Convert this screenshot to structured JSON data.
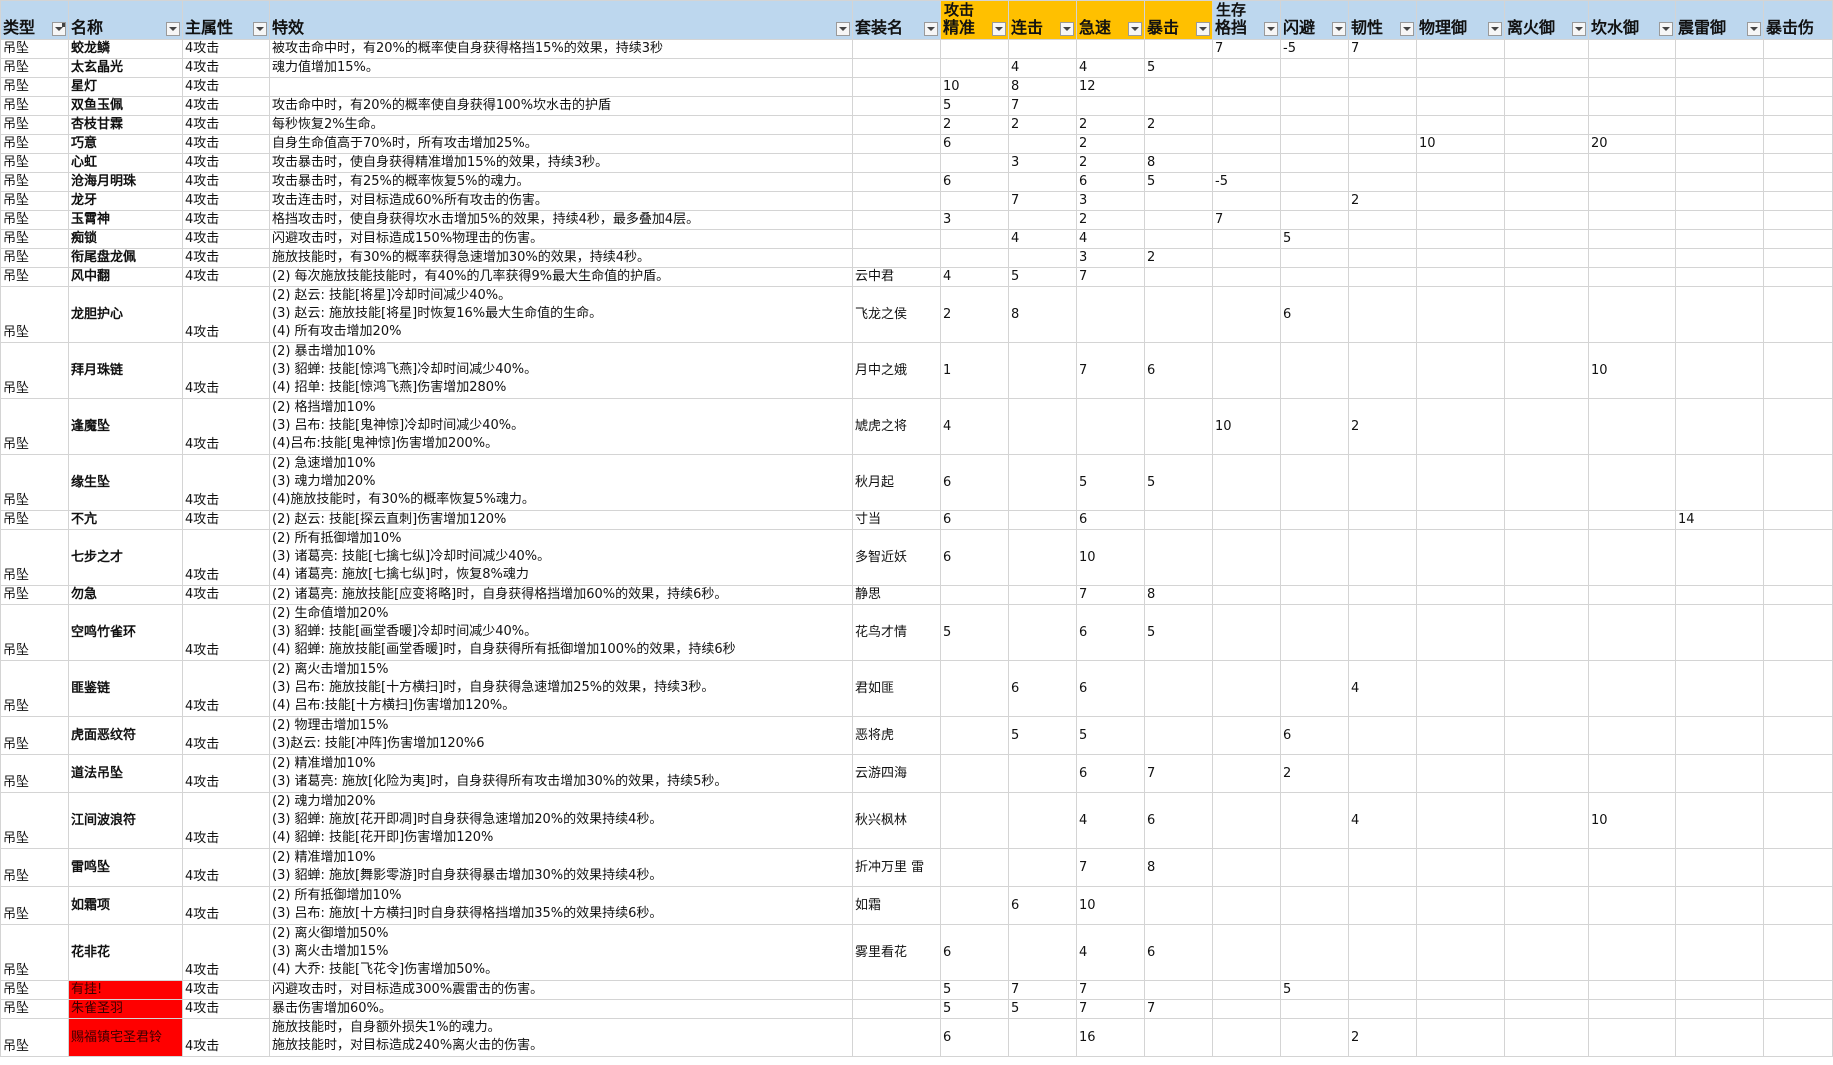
{
  "header": {
    "group_attack": "攻击",
    "group_survive": "生存",
    "columns": [
      "类型",
      "名称",
      "主属性",
      "特效",
      "套装名",
      "精准",
      "连击",
      "急速",
      "暴击",
      "格挡",
      "闪避",
      "韧性",
      "物理御",
      "离火御",
      "坎水御",
      "震雷御",
      "暴击伤"
    ]
  },
  "rows": [
    {
      "type": "吊坠",
      "name": "蛟龙鳞",
      "main": "4攻击",
      "effect": [
        "被攻击命中时，有20%的概率使自身获得格挡15%的效果，持续3秒"
      ],
      "set": "",
      "stats": [
        "",
        "",
        "",
        "",
        "7",
        "-5",
        "7",
        "",
        "",
        "",
        "",
        ""
      ]
    },
    {
      "type": "吊坠",
      "name": "太玄晶光",
      "main": "4攻击",
      "effect": [
        "魂力值增加15%。"
      ],
      "set": "",
      "stats": [
        "",
        "4",
        "4",
        "5",
        "",
        "",
        "",
        "",
        "",
        "",
        "",
        ""
      ]
    },
    {
      "type": "吊坠",
      "name": "星灯",
      "main": "4攻击",
      "effect": [
        ""
      ],
      "set": "",
      "stats": [
        "10",
        "8",
        "12",
        "",
        "",
        "",
        "",
        "",
        "",
        "",
        "",
        ""
      ]
    },
    {
      "type": "吊坠",
      "name": "双鱼玉佩",
      "main": "4攻击",
      "effect": [
        "攻击命中时，有20%的概率使自身获得100%坎水击的护盾"
      ],
      "set": "",
      "stats": [
        "5",
        "7",
        "",
        "",
        "",
        "",
        "",
        "",
        "",
        "",
        "",
        ""
      ]
    },
    {
      "type": "吊坠",
      "name": "杏枝甘霖",
      "main": "4攻击",
      "effect": [
        "每秒恢复2%生命。"
      ],
      "set": "",
      "stats": [
        "2",
        "2",
        "2",
        "2",
        "",
        "",
        "",
        "",
        "",
        "",
        "",
        ""
      ]
    },
    {
      "type": "吊坠",
      "name": "巧意",
      "main": "4攻击",
      "effect": [
        "自身生命值高于70%时，所有攻击增加25%。"
      ],
      "set": "",
      "stats": [
        "6",
        "",
        "2",
        "",
        "",
        "",
        "",
        "10",
        "",
        "20",
        "",
        ""
      ]
    },
    {
      "type": "吊坠",
      "name": "心虹",
      "main": "4攻击",
      "effect": [
        "攻击暴击时，使自身获得精准增加15%的效果，持续3秒。"
      ],
      "set": "",
      "stats": [
        "",
        "3",
        "2",
        "8",
        "",
        "",
        "",
        "",
        "",
        "",
        "",
        ""
      ]
    },
    {
      "type": "吊坠",
      "name": "沧海月明珠",
      "main": "4攻击",
      "effect": [
        "攻击暴击时，有25%的概率恢复5%的魂力。"
      ],
      "set": "",
      "stats": [
        "6",
        "",
        "6",
        "5",
        "-5",
        "",
        "",
        "",
        "",
        "",
        "",
        ""
      ]
    },
    {
      "type": "吊坠",
      "name": "龙牙",
      "main": "4攻击",
      "effect": [
        "攻击连击时，对目标造成60%所有攻击的伤害。"
      ],
      "set": "",
      "stats": [
        "",
        "7",
        "3",
        "",
        "",
        "",
        "2",
        "",
        "",
        "",
        "",
        ""
      ]
    },
    {
      "type": "吊坠",
      "name": "玉霄神",
      "main": "4攻击",
      "effect": [
        "格挡攻击时，使自身获得坎水击增加5%的效果，持续4秒，最多叠加4层。"
      ],
      "set": "",
      "stats": [
        "3",
        "",
        "2",
        "",
        "7",
        "",
        "",
        "",
        "",
        "",
        "",
        ""
      ]
    },
    {
      "type": "吊坠",
      "name": "痴锁",
      "main": "4攻击",
      "effect": [
        "闪避攻击时，对目标造成150%物理击的伤害。"
      ],
      "set": "",
      "stats": [
        "",
        "4",
        "4",
        "",
        "",
        "5",
        "",
        "",
        "",
        "",
        "",
        ""
      ]
    },
    {
      "type": "吊坠",
      "name": "衔尾盘龙佩",
      "main": "4攻击",
      "effect": [
        "施放技能时，有30%的概率获得急速增加30%的效果，持续4秒。"
      ],
      "set": "",
      "stats": [
        "",
        "",
        "3",
        "2",
        "",
        "",
        "",
        "",
        "",
        "",
        "",
        ""
      ]
    },
    {
      "type": "吊坠",
      "name": "风中翻",
      "main": "4攻击",
      "effect": [
        "(2) 每次施放技能技能时，有40%的几率获得9%最大生命值的护盾。"
      ],
      "set": "云中君",
      "stats": [
        "4",
        "5",
        "7",
        "",
        "",
        "",
        "",
        "",
        "",
        "",
        "",
        ""
      ]
    },
    {
      "type": "吊坠",
      "name": "龙胆护心",
      "main": "4攻击",
      "effect": [
        "(2) 赵云: 技能[将星]冷却时间减少40%。",
        "(3) 赵云: 施放技能[将星]时恢复16%最大生命值的生命。",
        "(4) 所有攻击增加20%"
      ],
      "set": "飞龙之侯",
      "stats": [
        "2",
        "8",
        "",
        "",
        "",
        "6",
        "",
        "",
        "",
        "",
        "",
        ""
      ]
    },
    {
      "type": "吊坠",
      "name": "拜月珠链",
      "main": "4攻击",
      "effect": [
        "(2) 暴击增加10%",
        "(3) 貂蝉: 技能[惊鸿飞燕]冷却时间减少40%。",
        "(4) 招单: 技能[惊鸿飞燕]伤害增加280%"
      ],
      "set": "月中之娥",
      "stats": [
        "1",
        "",
        "7",
        "6",
        "",
        "",
        "",
        "",
        "",
        "10",
        "",
        ""
      ]
    },
    {
      "type": "吊坠",
      "name": "逢魔坠",
      "main": "4攻击",
      "effect": [
        "(2) 格挡增加10%",
        "(3) 吕布: 技能[鬼神惊]冷却时间减少40%。",
        "(4)吕布:技能[鬼神惊]伤害增加200%。"
      ],
      "set": "虓虎之将",
      "stats": [
        "4",
        "",
        "",
        "",
        "10",
        "",
        "2",
        "",
        "",
        "",
        "",
        ""
      ]
    },
    {
      "type": "吊坠",
      "name": "缘生坠",
      "main": "4攻击",
      "effect": [
        "(2) 急速增加10%",
        "(3) 魂力增加20%",
        "(4)施放技能时，有30%的概率恢复5%魂力。"
      ],
      "set": "秋月起",
      "stats": [
        "6",
        "",
        "5",
        "5",
        "",
        "",
        "",
        "",
        "",
        "",
        "",
        ""
      ]
    },
    {
      "type": "吊坠",
      "name": "不亢",
      "main": "4攻击",
      "effect": [
        "(2) 赵云: 技能[探云直刺]伤害增加120%"
      ],
      "set": "寸当",
      "stats": [
        "6",
        "",
        "6",
        "",
        "",
        "",
        "",
        "",
        "",
        "",
        "14",
        ""
      ]
    },
    {
      "type": "吊坠",
      "name": "七步之才",
      "main": "4攻击",
      "effect": [
        "(2) 所有抵御增加10%",
        "(3) 诸葛亮: 技能[七擒七纵]冷却时间减少40%。",
        "(4) 诸葛亮: 施放[七擒七纵]时，恢复8%魂力"
      ],
      "set": "多智近妖",
      "stats": [
        "6",
        "",
        "10",
        "",
        "",
        "",
        "",
        "",
        "",
        "",
        "",
        ""
      ]
    },
    {
      "type": "吊坠",
      "name": "勿急",
      "main": "4攻击",
      "effect": [
        "(2) 诸葛亮: 施放技能[应变将略]时，自身获得格挡增加60%的效果，持续6秒。"
      ],
      "set": "静思",
      "stats": [
        "",
        "",
        "7",
        "8",
        "",
        "",
        "",
        "",
        "",
        "",
        "",
        ""
      ]
    },
    {
      "type": "吊坠",
      "name": "空鸣竹雀环",
      "main": "4攻击",
      "effect": [
        "(2) 生命值增加20%",
        "(3) 貂蝉: 技能[画堂香暖]冷却时间减少40%。",
        "(4) 貂蝉: 施放技能[画堂香暖]时，自身获得所有抵御增加100%的效果，持续6秒"
      ],
      "set": "花鸟才情",
      "stats": [
        "5",
        "",
        "6",
        "5",
        "",
        "",
        "",
        "",
        "",
        "",
        "",
        ""
      ]
    },
    {
      "type": "吊坠",
      "name": "匪鉴链",
      "main": "4攻击",
      "effect": [
        "(2) 离火击增加15%",
        "(3) 吕布: 施放技能[十方横扫]时，自身获得急速增加25%的效果，持续3秒。",
        "(4) 吕布:技能[十方横扫]伤害增加120%。"
      ],
      "set": "君如匪",
      "stats": [
        "",
        "6",
        "6",
        "",
        "",
        "",
        "4",
        "",
        "",
        "",
        "",
        ""
      ]
    },
    {
      "type": "吊坠",
      "name": "虎面恶纹符",
      "main": "4攻击",
      "effect": [
        "(2) 物理击增加15%",
        "(3)赵云: 技能[冲阵]伤害增加120%6"
      ],
      "set": "恶将虎",
      "stats": [
        "",
        "5",
        "5",
        "",
        "",
        "6",
        "",
        "",
        "",
        "",
        "",
        ""
      ]
    },
    {
      "type": "吊坠",
      "name": "道法吊坠",
      "main": "4攻击",
      "effect": [
        "(2) 精准增加10%",
        "(3) 诸葛亮: 施放[化险为夷]时，自身获得所有攻击增加30%的效果，持续5秒。"
      ],
      "set": "云游四海",
      "stats": [
        "",
        "",
        "6",
        "7",
        "",
        "2",
        "",
        "",
        "",
        "",
        "",
        ""
      ]
    },
    {
      "type": "吊坠",
      "name": "江间波浪符",
      "main": "4攻击",
      "effect": [
        "(2) 魂力增加20%",
        "(3) 貂蝉: 施放[花开即凋]时自身获得急速增加20%的效果持续4秒。",
        "(4) 貂蝉: 技能[花开即]伤害增加120%"
      ],
      "set": "秋兴枫林",
      "stats": [
        "",
        "",
        "4",
        "6",
        "",
        "",
        "4",
        "",
        "",
        "10",
        "",
        ""
      ]
    },
    {
      "type": "吊坠",
      "name": "雷鸣坠",
      "main": "4攻击",
      "effect": [
        "(2) 精准增加10%",
        "(3) 貂蝉: 施放[舞影零游]时自身获得暴击增加30%的效果持续4秒。"
      ],
      "set": "折冲万里 雷",
      "stats": [
        "",
        "",
        "7",
        "8",
        "",
        "",
        "",
        "",
        "",
        "",
        "",
        ""
      ]
    },
    {
      "type": "吊坠",
      "name": "如霜项",
      "main": "4攻击",
      "effect": [
        "(2) 所有抵御增加10%",
        "(3) 吕布: 施放[十方横扫]时自身获得格挡增加35%的效果持续6秒。"
      ],
      "set": "如霜",
      "stats": [
        "",
        "6",
        "10",
        "",
        "",
        "",
        "",
        "",
        "",
        "",
        "",
        ""
      ]
    },
    {
      "type": "吊坠",
      "name": "花非花",
      "main": "4攻击",
      "effect": [
        "(2) 离火御增加50%",
        "(3) 离火击增加15%",
        "(4) 大乔: 技能[飞花令]伤害增加50%。"
      ],
      "set": "雾里看花",
      "stats": [
        "6",
        "",
        "4",
        "6",
        "",
        "",
        "",
        "",
        "",
        "",
        "",
        ""
      ]
    },
    {
      "type": "吊坠",
      "name": "有挂!",
      "main": "4攻击",
      "effect": [
        "闪避攻击时，对目标造成300%震雷击的伤害。"
      ],
      "set": "",
      "stats": [
        "5",
        "7",
        "7",
        "",
        "",
        "5",
        "",
        "",
        "",
        "",
        "",
        ""
      ],
      "red": true
    },
    {
      "type": "吊坠",
      "name": "朱雀圣羽",
      "main": "4攻击",
      "effect": [
        "暴击伤害增加60%。"
      ],
      "set": "",
      "stats": [
        "5",
        "5",
        "7",
        "7",
        "",
        "",
        "",
        "",
        "",
        "",
        "",
        ""
      ],
      "red": true
    },
    {
      "type": "吊坠",
      "name": "赐福镇宅圣君铃",
      "main": "4攻击",
      "effect": [
        "施放技能时，自身额外损失1%的魂力。",
        "施放技能时，对目标造成240%离火击的伤害。"
      ],
      "set": "",
      "stats": [
        "6",
        "",
        "16",
        "",
        "",
        "",
        "2",
        "",
        "",
        "",
        "",
        ""
      ],
      "red": true
    }
  ]
}
